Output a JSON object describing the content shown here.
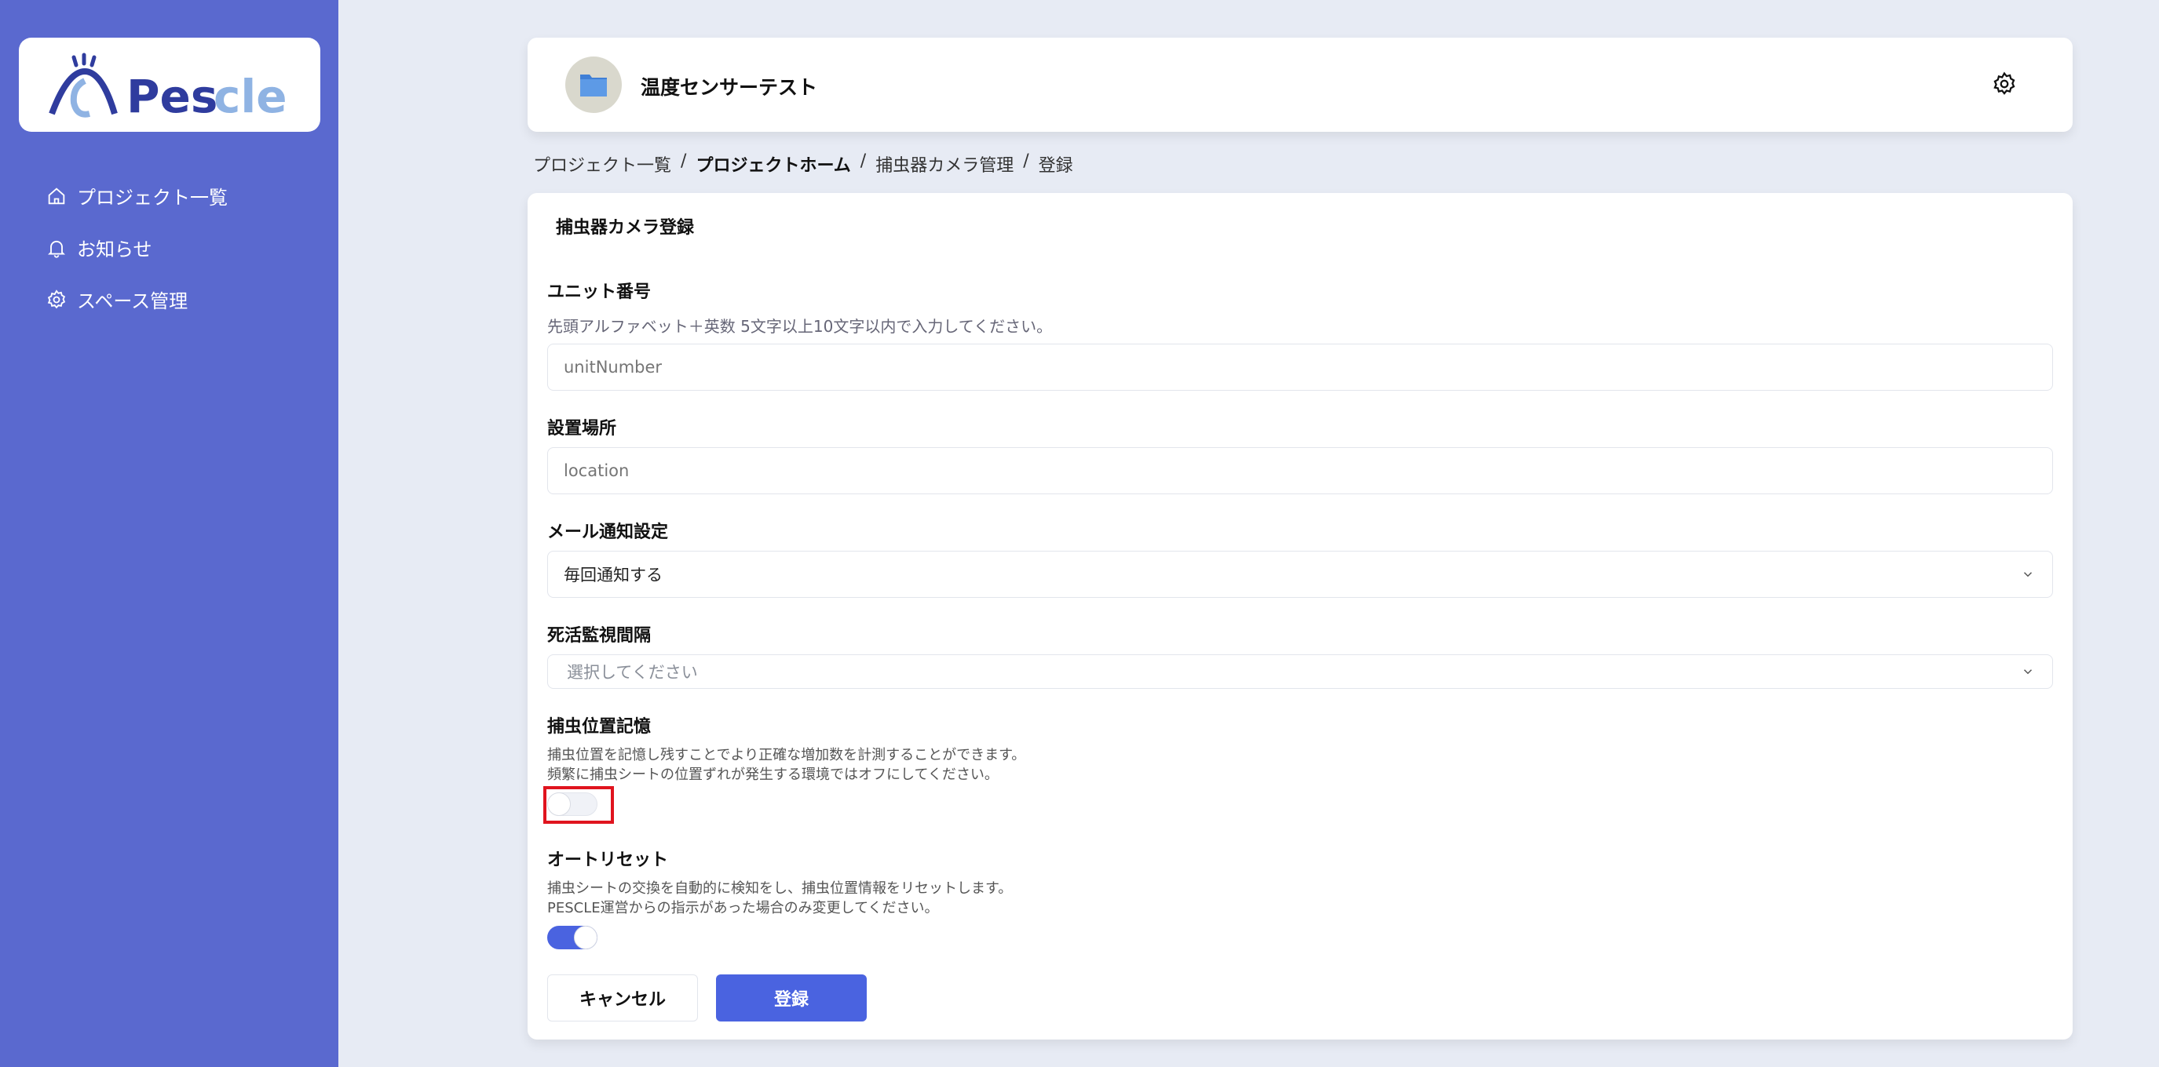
{
  "brand": {
    "name": "Pescle",
    "colors": {
      "sidebar": "#5a69cf",
      "accent": "#4a63e0",
      "logo_dark": "#2f3c9e",
      "logo_light": "#8fb3e3"
    }
  },
  "sidebar": {
    "items": [
      {
        "label": "プロジェクト一覧",
        "icon": "home-icon"
      },
      {
        "label": "お知らせ",
        "icon": "bell-icon"
      },
      {
        "label": "スペース管理",
        "icon": "gear-icon"
      }
    ]
  },
  "header": {
    "title": "温度センサーテスト",
    "icon": "folder-icon"
  },
  "breadcrumb": [
    "プロジェクト一覧",
    "/",
    "プロジェクトホーム",
    "/",
    "捕虫器カメラ管理",
    "/",
    "登録"
  ],
  "form": {
    "title": "捕虫器カメラ登録",
    "unit_number": {
      "label": "ユニット番号",
      "hint": "先頭アルファベット＋英数 5文字以上10文字以内で入力してください。",
      "placeholder": "unitNumber"
    },
    "location": {
      "label": "設置場所",
      "placeholder": "location"
    },
    "mail": {
      "label": "メール通知設定",
      "value": "毎回通知する"
    },
    "monitor": {
      "label": "死活監視間隔",
      "placeholder": "選択してください"
    },
    "position_memory": {
      "label": "捕虫位置記憶",
      "desc1": "捕虫位置を記憶し残すことでより正確な増加数を計測することができます。",
      "desc2": "頻繁に捕虫シートの位置ずれが発生する環境ではオフにしてください。",
      "enabled": false
    },
    "auto_reset": {
      "label": "オートリセット",
      "desc1": "捕虫シートの交換を自動的に検知をし、捕虫位置情報をリセットします。",
      "desc2": "PESCLE運営からの指示があった場合のみ変更してください。",
      "enabled": true
    },
    "cancel_label": "キャンセル",
    "submit_label": "登録"
  }
}
